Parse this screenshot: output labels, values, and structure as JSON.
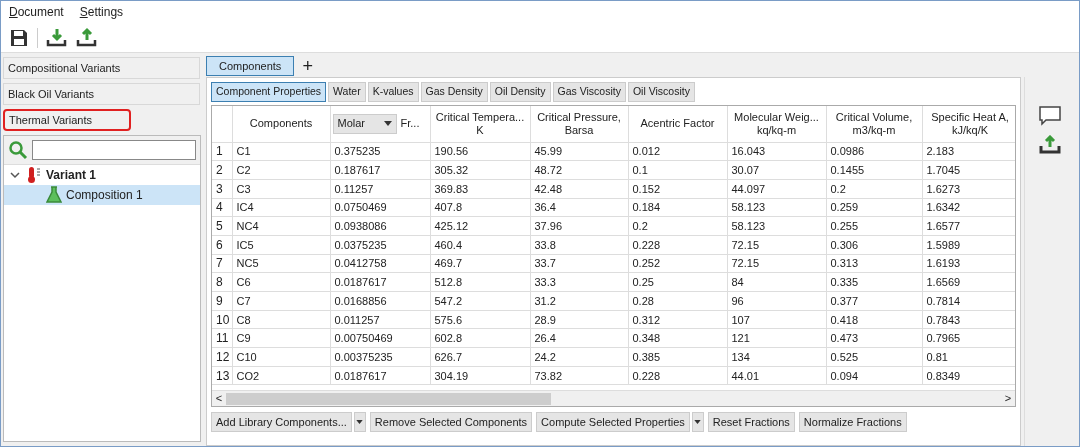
{
  "menu": [
    {
      "label": "Document"
    },
    {
      "label": "Settings"
    }
  ],
  "variant_sections": [
    {
      "label": "Compositional Variants",
      "highlighted": false
    },
    {
      "label": "Black Oil Variants",
      "highlighted": false
    },
    {
      "label": "Thermal Variants",
      "highlighted": true
    }
  ],
  "tree": [
    {
      "label": "Variant 1",
      "kind": "variant",
      "expanded": true,
      "selected": false,
      "children": [
        {
          "label": "Composition 1",
          "kind": "composition",
          "selected": true
        }
      ]
    }
  ],
  "top_tabs": [
    {
      "label": "Components",
      "selected": true
    }
  ],
  "add_tab": "+",
  "sub_tabs": [
    {
      "label": "Component Properties",
      "selected": true
    },
    {
      "label": "Water",
      "selected": false
    },
    {
      "label": "K-values",
      "selected": false
    },
    {
      "label": "Gas Density",
      "selected": false
    },
    {
      "label": "Oil Density",
      "selected": false
    },
    {
      "label": "Gas Viscosity",
      "selected": false
    },
    {
      "label": "Oil Viscosity",
      "selected": false
    }
  ],
  "table": {
    "columns": [
      {
        "kind": "index"
      },
      {
        "kind": "text",
        "label": "Components"
      },
      {
        "kind": "dropdown",
        "value": "Molar",
        "suffix": "Fr..."
      },
      {
        "kind": "text",
        "label": "Critical Tempera...\nK"
      },
      {
        "kind": "text",
        "label": "Critical Pressure,\nBarsa"
      },
      {
        "kind": "text",
        "label": "Acentric Factor"
      },
      {
        "kind": "text",
        "label": "Molecular Weig...\nkq/kq-m"
      },
      {
        "kind": "text",
        "label": "Critical Volume,\nm3/kq-m"
      },
      {
        "kind": "text",
        "label": "Specific Heat A,\nkJ/kq/K"
      }
    ],
    "rows": [
      [
        "1",
        "C1",
        "0.375235",
        "190.56",
        "45.99",
        "0.012",
        "16.043",
        "0.0986",
        "2.183"
      ],
      [
        "2",
        "C2",
        "0.187617",
        "305.32",
        "48.72",
        "0.1",
        "30.07",
        "0.1455",
        "1.7045"
      ],
      [
        "3",
        "C3",
        "0.11257",
        "369.83",
        "42.48",
        "0.152",
        "44.097",
        "0.2",
        "1.6273"
      ],
      [
        "4",
        "IC4",
        "0.0750469",
        "407.8",
        "36.4",
        "0.184",
        "58.123",
        "0.259",
        "1.6342"
      ],
      [
        "5",
        "NC4",
        "0.0938086",
        "425.12",
        "37.96",
        "0.2",
        "58.123",
        "0.255",
        "1.6577"
      ],
      [
        "6",
        "IC5",
        "0.0375235",
        "460.4",
        "33.8",
        "0.228",
        "72.15",
        "0.306",
        "1.5989"
      ],
      [
        "7",
        "NC5",
        "0.0412758",
        "469.7",
        "33.7",
        "0.252",
        "72.15",
        "0.313",
        "1.6193"
      ],
      [
        "8",
        "C6",
        "0.0187617",
        "512.8",
        "33.3",
        "0.25",
        "84",
        "0.335",
        "1.6569"
      ],
      [
        "9",
        "C7",
        "0.0168856",
        "547.2",
        "31.2",
        "0.28",
        "96",
        "0.377",
        "0.7814"
      ],
      [
        "10",
        "C8",
        "0.011257",
        "575.6",
        "28.9",
        "0.312",
        "107",
        "0.418",
        "0.7843"
      ],
      [
        "11",
        "C9",
        "0.00750469",
        "602.8",
        "26.4",
        "0.348",
        "121",
        "0.473",
        "0.7965"
      ],
      [
        "12",
        "C10",
        "0.00375235",
        "626.7",
        "24.2",
        "0.385",
        "134",
        "0.525",
        "0.81"
      ],
      [
        "13",
        "CO2",
        "0.0187617",
        "304.19",
        "73.82",
        "0.228",
        "44.01",
        "0.094",
        "0.8349"
      ]
    ],
    "scroll_left": "<",
    "scroll_right": ">"
  },
  "actions": [
    {
      "label": "Add Library Components...",
      "dropdown": true
    },
    {
      "label": "Remove Selected Components",
      "dropdown": false
    },
    {
      "label": "Compute Selected Properties",
      "dropdown": true
    },
    {
      "label": "Reset Fractions",
      "dropdown": false
    },
    {
      "label": "Normalize Fractions",
      "dropdown": false
    }
  ]
}
